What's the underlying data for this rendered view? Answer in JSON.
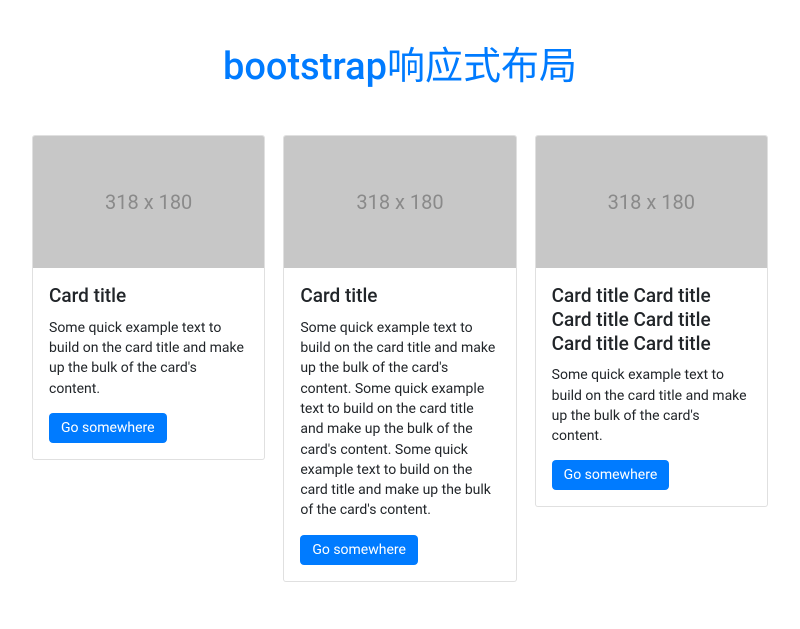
{
  "header": {
    "title": "bootstrap响应式布局"
  },
  "cards": [
    {
      "image_placeholder": "318 x 180",
      "title": "Card title",
      "text": "Some quick example text to build on the card title and make up the bulk of the card's content.",
      "button_label": "Go somewhere"
    },
    {
      "image_placeholder": "318 x 180",
      "title": "Card title",
      "text": "Some quick example text to build on the card title and make up the bulk of the card's content. Some quick example text to build on the card title and make up the bulk of the card's content. Some quick example text to build on the card title and make up the bulk of the card's content.",
      "button_label": "Go somewhere"
    },
    {
      "image_placeholder": "318 x 180",
      "title": "Card title Card title Card title Card title Card title Card title",
      "text": "Some quick example text to build on the card title and make up the bulk of the card's content.",
      "button_label": "Go somewhere"
    }
  ]
}
